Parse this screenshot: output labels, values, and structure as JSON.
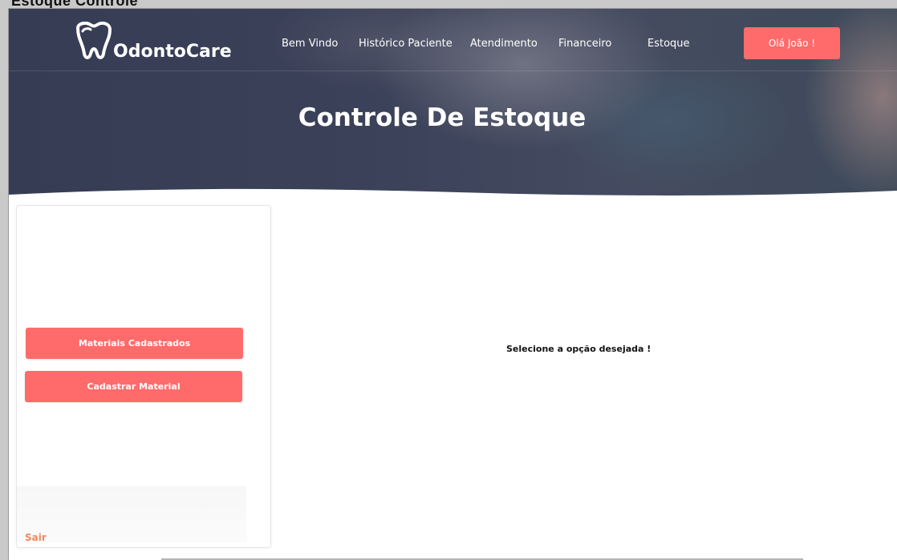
{
  "brand": {
    "name": "OdontoCare",
    "icon": "tooth-logo-icon"
  },
  "nav": {
    "items": [
      {
        "label": "Bem Vindo"
      },
      {
        "label": "Histórico Paciente"
      },
      {
        "label": "Atendimento"
      },
      {
        "label": "Financeiro"
      },
      {
        "label": "Estoque"
      }
    ],
    "user_label": "Olá João !"
  },
  "page": {
    "title": "Controle De Estoque"
  },
  "sidebar": {
    "buttons": [
      {
        "label": "Materiais Cadastrados"
      },
      {
        "label": "Cadastrar Material"
      }
    ],
    "logout_label": "Sair"
  },
  "main": {
    "message": "Selecione a opção desejada !"
  },
  "colors": {
    "accent": "#ff6b6b",
    "hero": "#3b4159",
    "logout": "#f08a5d"
  }
}
